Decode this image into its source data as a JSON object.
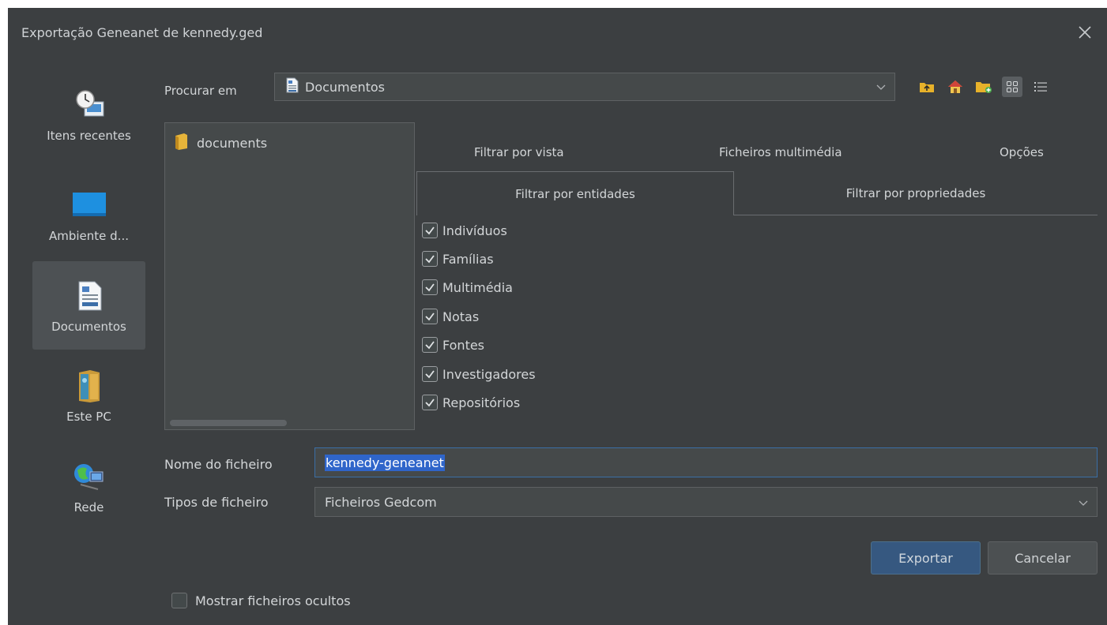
{
  "window": {
    "title": "Exportação Geneanet de kennedy.ged",
    "close_icon": "close-icon"
  },
  "sidebar": {
    "items": [
      {
        "label": "Itens recentes",
        "icon": "recent-items-icon",
        "selected": false
      },
      {
        "label": "Ambiente d...",
        "icon": "desktop-icon",
        "selected": false
      },
      {
        "label": "Documentos",
        "icon": "documents-icon",
        "selected": true
      },
      {
        "label": "Este PC",
        "icon": "this-pc-icon",
        "selected": false
      },
      {
        "label": "Rede",
        "icon": "network-icon",
        "selected": false
      }
    ]
  },
  "look_in": {
    "label": "Procurar em",
    "value": "Documentos"
  },
  "toolbar": {
    "icons": [
      "up-folder-icon",
      "home-icon",
      "new-folder-icon",
      "grid-view-icon",
      "list-view-icon"
    ]
  },
  "file_list": {
    "items": [
      {
        "name": "documents",
        "icon": "folder-icon"
      }
    ]
  },
  "tabs": {
    "top": [
      "Filtrar por vista",
      "Ficheiros multimédia",
      "Opções"
    ],
    "second": [
      "Filtrar por entidades",
      "Filtrar por propriedades"
    ],
    "active": "Filtrar por entidades"
  },
  "entities": [
    {
      "label": "Indivíduos",
      "checked": true
    },
    {
      "label": "Famílias",
      "checked": true
    },
    {
      "label": "Multimédia",
      "checked": true
    },
    {
      "label": "Notas",
      "checked": true
    },
    {
      "label": "Fontes",
      "checked": true
    },
    {
      "label": "Investigadores",
      "checked": true
    },
    {
      "label": "Repositórios",
      "checked": true
    }
  ],
  "file_name": {
    "label": "Nome do ficheiro",
    "value": "kennedy-geneanet"
  },
  "file_type": {
    "label": "Tipos de ficheiro",
    "value": "Ficheiros Gedcom"
  },
  "buttons": {
    "export": "Exportar",
    "cancel": "Cancelar"
  },
  "show_hidden": {
    "label": "Mostrar ficheiros ocultos",
    "checked": false
  },
  "colors": {
    "background": "#3c3f41",
    "field": "#45494a",
    "accent": "#365880",
    "selection": "#2f65ca"
  }
}
